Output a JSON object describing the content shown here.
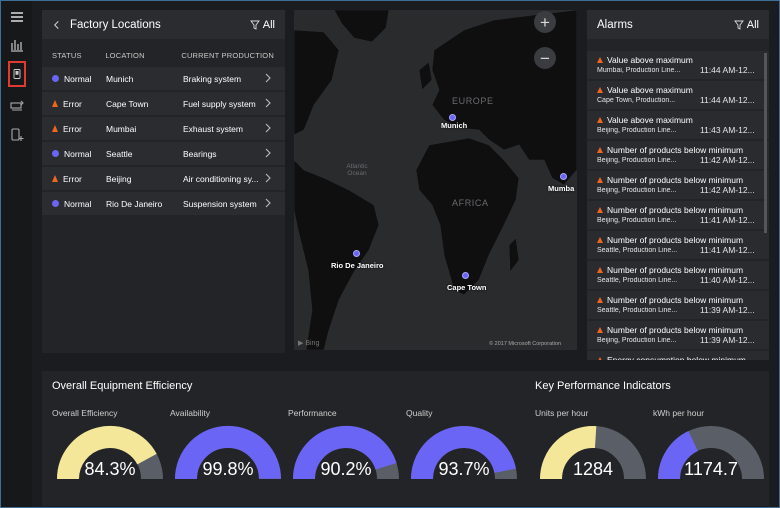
{
  "factory": {
    "title": "Factory Locations",
    "filter_label": "All",
    "columns": [
      "STATUS",
      "LOCATION",
      "CURRENT PRODUCTION"
    ],
    "rows": [
      {
        "status": "Normal",
        "location": "Munich",
        "production": "Braking system"
      },
      {
        "status": "Error",
        "location": "Cape Town",
        "production": "Fuel supply system"
      },
      {
        "status": "Error",
        "location": "Mumbai",
        "production": "Exhaust system"
      },
      {
        "status": "Normal",
        "location": "Seattle",
        "production": "Bearings"
      },
      {
        "status": "Error",
        "location": "Beijing",
        "production": "Air conditioning sy..."
      },
      {
        "status": "Normal",
        "location": "Rio De Janeiro",
        "production": "Suspension system"
      }
    ]
  },
  "map": {
    "zoom_in": "+",
    "zoom_out": "−",
    "regions": [
      "EUROPE",
      "AFRICA",
      "Atlantic Ocean"
    ],
    "cities": [
      "Munich",
      "Mumba",
      "Rio De Janeiro",
      "Cape Town"
    ],
    "copyright": "© 2017 Microsoft Corporation",
    "provider": "Bing"
  },
  "alarms": {
    "title": "Alarms",
    "filter_label": "All",
    "items": [
      {
        "title": "Value above maximum",
        "source": "Mumbai, Production Line...",
        "time": "11:44 AM-12..."
      },
      {
        "title": "Value above maximum",
        "source": "Cape Town, Production...",
        "time": "11:44 AM-12..."
      },
      {
        "title": "Value above maximum",
        "source": "Beijing, Production Line...",
        "time": "11:43 AM-12..."
      },
      {
        "title": "Number of products below minimum",
        "source": "Beijing, Production Line...",
        "time": "11:42 AM-12..."
      },
      {
        "title": "Number of products below minimum",
        "source": "Beijing, Production Line...",
        "time": "11:42 AM-12..."
      },
      {
        "title": "Number of products below minimum",
        "source": "Beijing, Production Line...",
        "time": "11:41 AM-12..."
      },
      {
        "title": "Number of products below minimum",
        "source": "Seattle, Production Line...",
        "time": "11:41 AM-12..."
      },
      {
        "title": "Number of products below minimum",
        "source": "Seattle, Production Line...",
        "time": "11:40 AM-12..."
      },
      {
        "title": "Number of products below minimum",
        "source": "Seattle, Production Line...",
        "time": "11:39 AM-12..."
      },
      {
        "title": "Number of products below minimum",
        "source": "Beijing, Production Line...",
        "time": "11:39 AM-12..."
      },
      {
        "title": "Energy consumption below minimum",
        "source": "",
        "time": ""
      }
    ]
  },
  "oee": {
    "title": "Overall Equipment Efficiency",
    "gauges": [
      {
        "label": "Overall Efficiency",
        "value": "84.3%",
        "fraction": 0.843,
        "color": "#f4e79a"
      },
      {
        "label": "Availability",
        "value": "99.8%",
        "fraction": 0.998,
        "color": "#6b65f5"
      },
      {
        "label": "Performance",
        "value": "90.2%",
        "fraction": 0.902,
        "color": "#6b65f5"
      },
      {
        "label": "Quality",
        "value": "93.7%",
        "fraction": 0.937,
        "color": "#6b65f5"
      }
    ]
  },
  "kpi": {
    "title": "Key Performance Indicators",
    "gauges": [
      {
        "label": "Units per hour",
        "value": "1284",
        "fraction": 0.52,
        "color": "#f4e79a"
      },
      {
        "label": "kWh per hour",
        "value": "1174.7",
        "fraction": 0.36,
        "color": "#6b65f5"
      }
    ]
  },
  "colors": {
    "accent": "#6b65f5",
    "warning": "#f1661f",
    "yellow": "#f4e79a",
    "track": "#5a5e66"
  }
}
